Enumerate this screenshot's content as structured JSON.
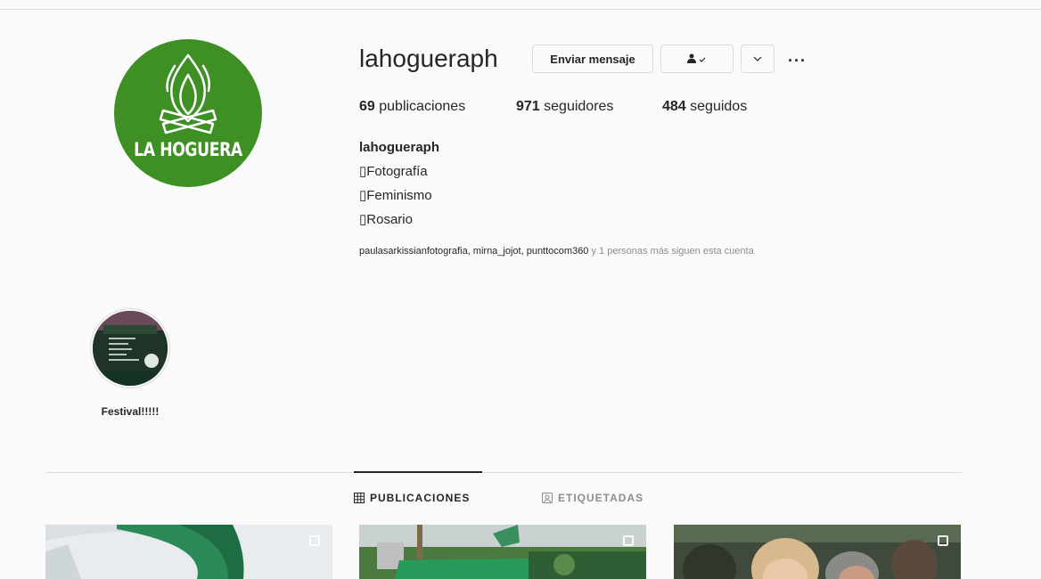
{
  "profile": {
    "username": "lahogueraph",
    "avatar_text": "LA HOGUERA",
    "message_button": "Enviar mensaje",
    "more_options": "···",
    "stats": {
      "posts_count": "69",
      "posts_label": "publicaciones",
      "followers_count": "971",
      "followers_label": "seguidores",
      "following_count": "484",
      "following_label": "seguidos"
    },
    "bio": {
      "name": "lahogueraph",
      "lines": [
        "Fotografía",
        "Feminismo",
        "Rosario"
      ]
    },
    "followed_by": {
      "names": "paulasarkissianfotografia, mirna_jojot, punttocom360",
      "suffix": " y 1 personas más siguen esta cuenta"
    }
  },
  "highlights": [
    {
      "label": "Festival!!!!!"
    }
  ],
  "tabs": {
    "posts": "PUBLICACIONES",
    "tagged": "ETIQUETADAS"
  },
  "colors": {
    "avatar_green": "#3e8f24",
    "border": "#dbdbdb",
    "muted_text": "#8e8e8e"
  }
}
